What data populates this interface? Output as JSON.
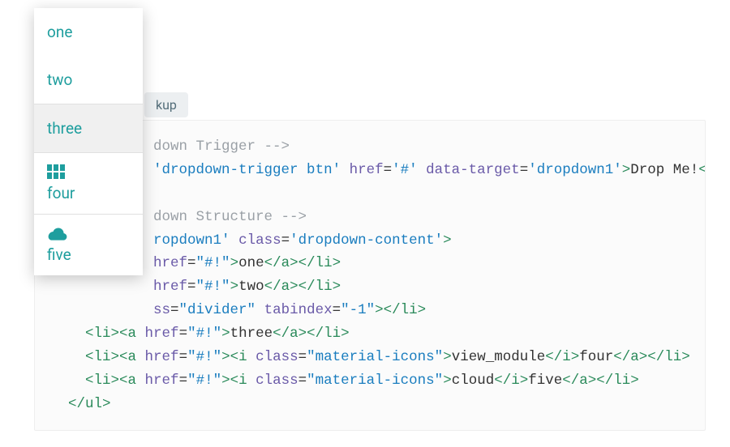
{
  "colors": {
    "teal": "#1e9e9e"
  },
  "tab": {
    "markup_label": "kup"
  },
  "dropdown": {
    "items": [
      {
        "label": "one",
        "icon": null,
        "hovered": false
      },
      {
        "label": "two",
        "icon": null,
        "hovered": false
      },
      {
        "label": "three",
        "icon": null,
        "hovered": true
      },
      {
        "label": "four",
        "icon": "view_module",
        "hovered": false
      },
      {
        "label": "five",
        "icon": "cloud",
        "hovered": false
      }
    ]
  },
  "code": {
    "comment1": "down Trigger -->",
    "trigger_class": "'dropdown-trigger btn'",
    "trigger_href": "'#'",
    "trigger_target": "'dropdown1'",
    "trigger_text": "Drop Me!",
    "comment2": "down Structure -->",
    "ul_id": "ropdown1'",
    "ul_class": "'dropdown-content'",
    "href_hash": "\"#!\"",
    "li_one": "one",
    "li_two": "two",
    "divider_class": "\"divider\"",
    "tabindex": "\"-1\"",
    "li_three": "three",
    "icon_class": "\"material-icons\"",
    "icon1_text": "view_module",
    "li_four": "four",
    "icon2_text": "cloud",
    "li_five": "five"
  }
}
